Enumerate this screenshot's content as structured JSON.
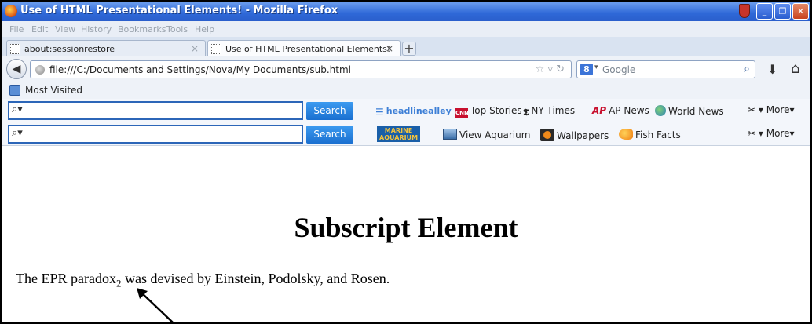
{
  "window": {
    "title": "Use of HTML Presentational Elements! - Mozilla Firefox"
  },
  "menu": [
    "File",
    "Edit",
    "View",
    "History",
    "Bookmarks",
    "Tools",
    "Help"
  ],
  "tabs": [
    {
      "label": "about:sessionrestore",
      "active": false
    },
    {
      "label": "Use of HTML Presentational Elements!",
      "active": true
    }
  ],
  "nav": {
    "url": "file:///C:/Documents and Settings/Nova/My Documents/sub.html",
    "search_placeholder": "Google"
  },
  "bookmarks": {
    "most_visited": "Most Visited"
  },
  "toolbar1": {
    "search_button": "Search",
    "brand": "headlinealley",
    "items": [
      "Top Stories",
      "NY Times",
      "AP News",
      "World News"
    ],
    "more": "More"
  },
  "toolbar2": {
    "search_button": "Search",
    "brand_line1": "MARINE",
    "brand_line2": "AQUARIUM",
    "items": [
      "View Aquarium",
      "Wallpapers",
      "Fish Facts"
    ],
    "more": "More"
  },
  "page": {
    "heading": "Subscript Element",
    "para_before": "The EPR paradox",
    "para_sub": "2",
    "para_after": " was devised by Einstein, Podolsky, and Rosen."
  }
}
